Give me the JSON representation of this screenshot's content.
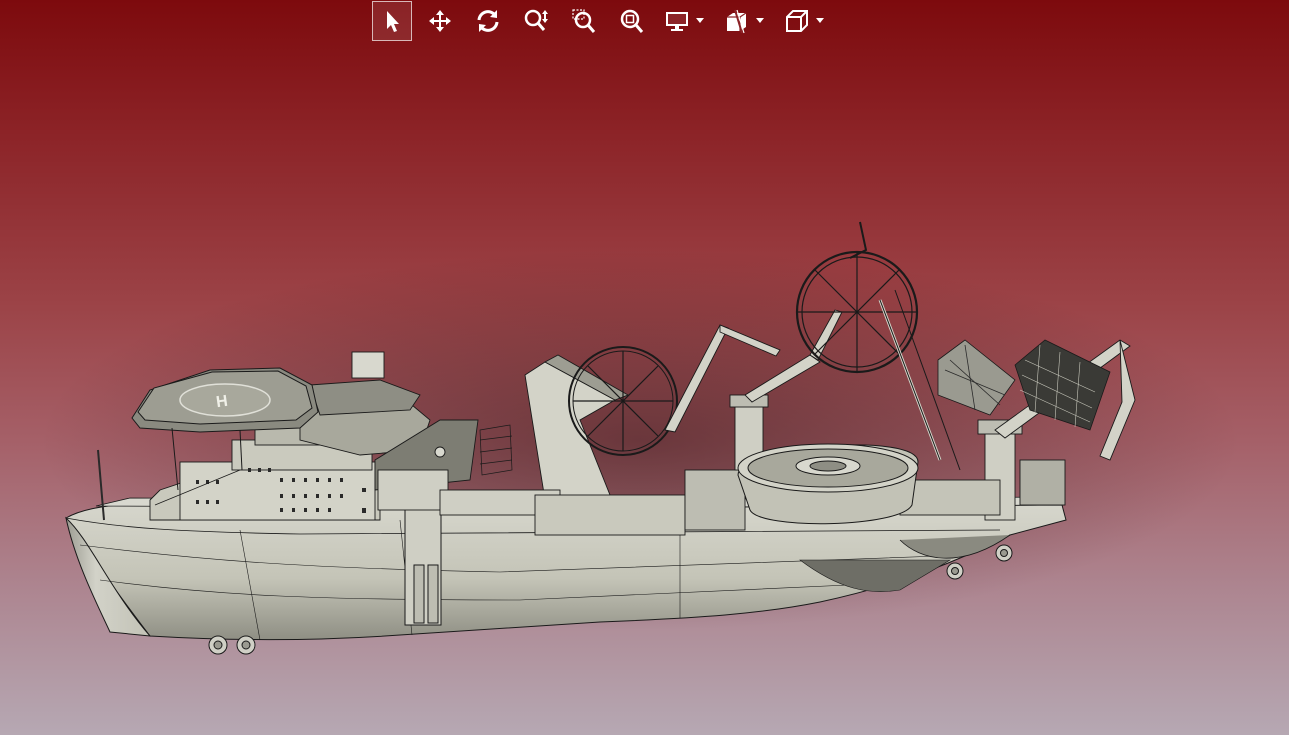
{
  "app": {
    "kind": "3d-model-viewer"
  },
  "toolbar": {
    "tools": [
      {
        "icon": "select-arrow-icon",
        "active": true
      },
      {
        "icon": "pan-move-icon",
        "active": false
      },
      {
        "icon": "rotate-icon",
        "active": false
      },
      {
        "icon": "zoom-icon",
        "active": false
      },
      {
        "icon": "zoom-window-icon",
        "active": false
      },
      {
        "icon": "zoom-fit-icon",
        "active": false
      },
      {
        "icon": "display-mode-icon",
        "active": false,
        "has_dropdown": true
      },
      {
        "icon": "section-view-icon",
        "active": false,
        "has_dropdown": true
      },
      {
        "icon": "view-cube-icon",
        "active": false,
        "has_dropdown": true
      }
    ],
    "icon_color": "#ffffff"
  },
  "viewport": {
    "background_top": "#7d0a0d",
    "background_bottom": "#b6a8b3"
  },
  "model": {
    "subject": "cable-laying-ship-cad-model",
    "hull_color": "#c8c8bc",
    "edge_color": "#1a1a1a",
    "helipad_marking": "H"
  }
}
